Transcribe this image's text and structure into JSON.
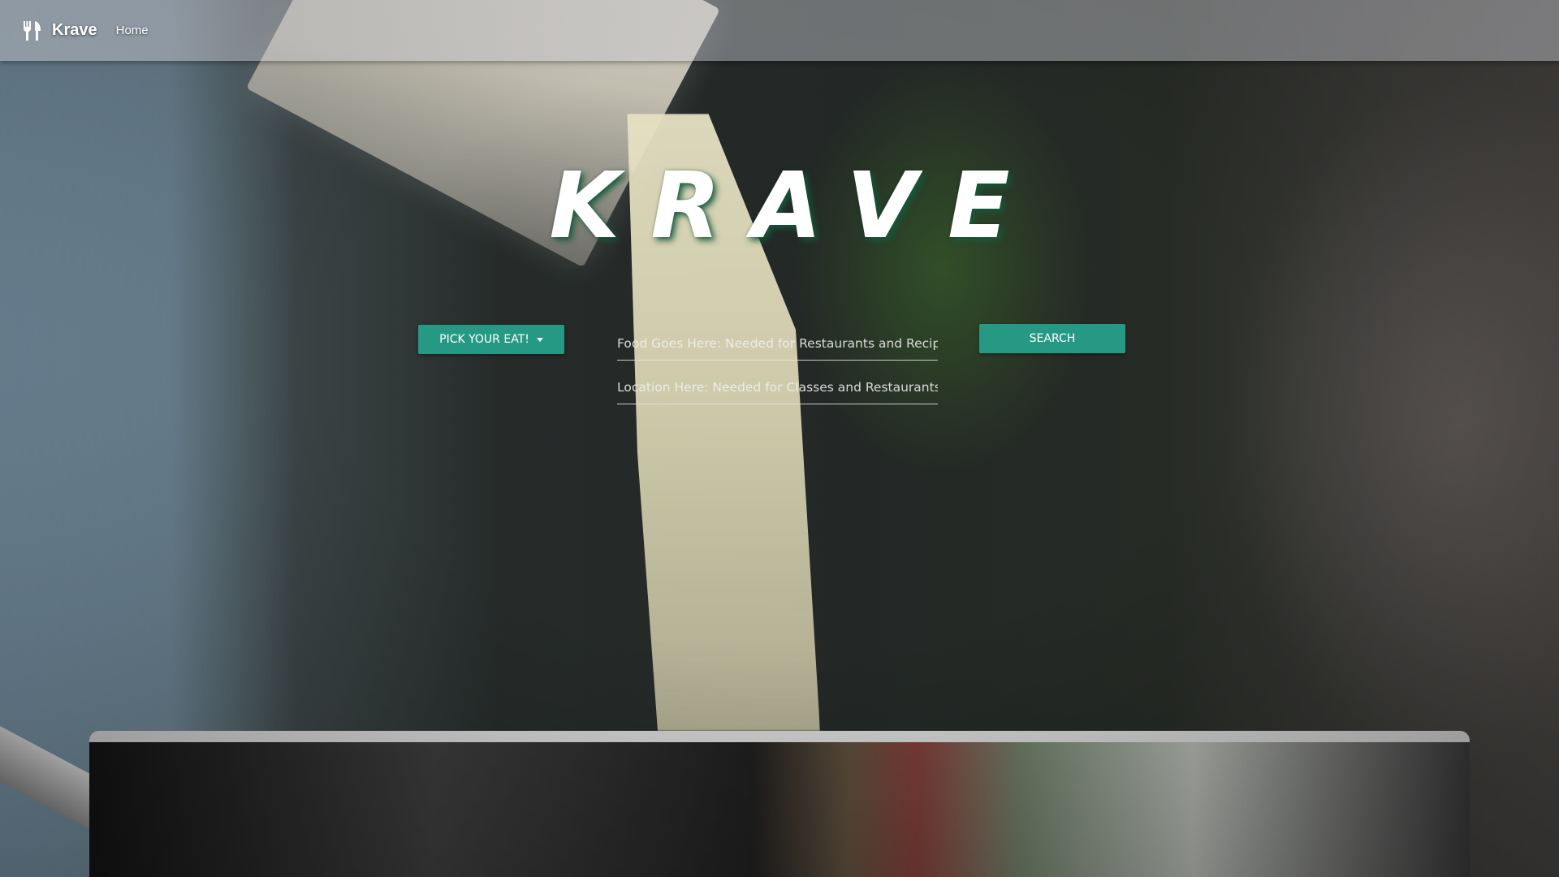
{
  "navbar": {
    "brand_icon": "fork-knife-icon",
    "brand": "Krave",
    "links": [
      {
        "label": "Home"
      }
    ]
  },
  "hero": {
    "title": "KRAVE"
  },
  "search": {
    "dropdown_label": "PICK YOUR EAT!",
    "dropdown_icon": "caret-down-icon",
    "food_placeholder": "Food Goes Here: Needed for Restaurants and Recipes",
    "location_placeholder": "Location Here: Needed for Classes and Restaurants",
    "submit_label": "SEARCH"
  },
  "colors": {
    "accent": "#269985",
    "navbar": "#cdcdd2",
    "title_shadow": "#145a3c"
  }
}
